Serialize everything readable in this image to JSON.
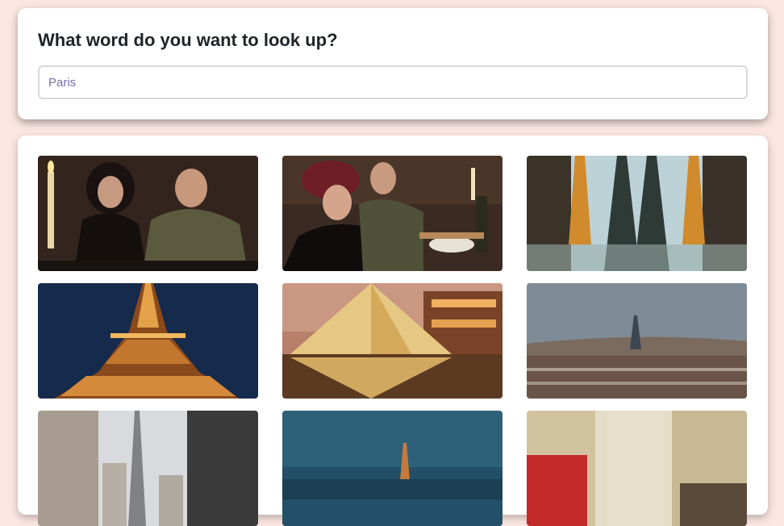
{
  "search": {
    "title": "What word do you want to look up?",
    "value": "Paris"
  },
  "gallery": {
    "photos": [
      {
        "name": "couple-candlelit-dinner-photo"
      },
      {
        "name": "woman-beret-restaurant-photo"
      },
      {
        "name": "eiffel-tower-mirrored-photo"
      },
      {
        "name": "eiffel-tower-night-photo"
      },
      {
        "name": "louvre-pyramid-photo"
      },
      {
        "name": "paris-skyline-photo"
      },
      {
        "name": "paris-street-eiffel-photo"
      },
      {
        "name": "eiffel-tower-dusk-photo"
      },
      {
        "name": "paris-street-shops-photo"
      }
    ]
  }
}
